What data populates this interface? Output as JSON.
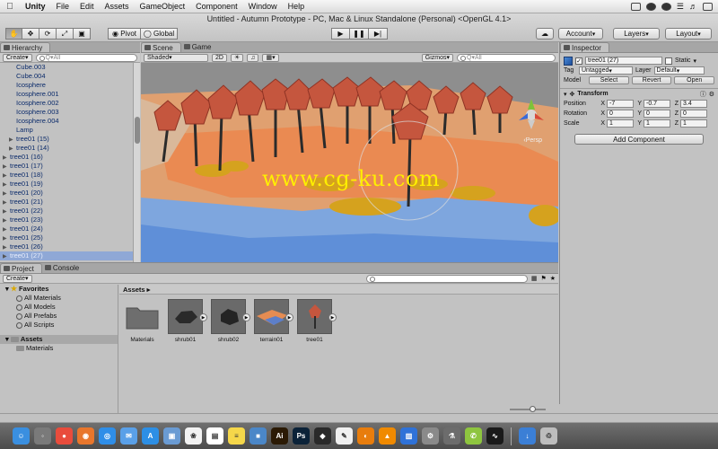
{
  "menubar": {
    "app": "Unity",
    "items": [
      "File",
      "Edit",
      "Assets",
      "GameObject",
      "Component",
      "Window",
      "Help"
    ]
  },
  "window_title": "Untitled - Autumn Prototype - PC, Mac & Linux Standalone (Personal) <OpenGL 4.1>",
  "toolbar": {
    "pivot_label": "Pivot",
    "global_label": "Global",
    "account_label": "Account",
    "layers_label": "Layers",
    "layout_label": "Layout"
  },
  "hierarchy": {
    "tab_label": "Hierarchy",
    "create_label": "Create",
    "search_placeholder": "Q▾All",
    "items": [
      {
        "label": "Cube.003",
        "expandable": false,
        "indent": 1
      },
      {
        "label": "Cube.004",
        "expandable": false,
        "indent": 1
      },
      {
        "label": "Icosphere",
        "expandable": false,
        "indent": 1
      },
      {
        "label": "Icosphere.001",
        "expandable": false,
        "indent": 1
      },
      {
        "label": "Icosphere.002",
        "expandable": false,
        "indent": 1
      },
      {
        "label": "Icosphere.003",
        "expandable": false,
        "indent": 1
      },
      {
        "label": "Icosphere.004",
        "expandable": false,
        "indent": 1
      },
      {
        "label": "Lamp",
        "expandable": false,
        "indent": 1
      },
      {
        "label": "tree01 (15)",
        "expandable": true,
        "indent": 1
      },
      {
        "label": "tree01 (14)",
        "expandable": true,
        "indent": 1
      },
      {
        "label": "tree01 (16)",
        "expandable": true,
        "indent": 0
      },
      {
        "label": "tree01 (17)",
        "expandable": true,
        "indent": 0
      },
      {
        "label": "tree01 (18)",
        "expandable": true,
        "indent": 0
      },
      {
        "label": "tree01 (19)",
        "expandable": true,
        "indent": 0
      },
      {
        "label": "tree01 (20)",
        "expandable": true,
        "indent": 0
      },
      {
        "label": "tree01 (21)",
        "expandable": true,
        "indent": 0
      },
      {
        "label": "tree01 (22)",
        "expandable": true,
        "indent": 0
      },
      {
        "label": "tree01 (23)",
        "expandable": true,
        "indent": 0
      },
      {
        "label": "tree01 (24)",
        "expandable": true,
        "indent": 0
      },
      {
        "label": "tree01 (25)",
        "expandable": true,
        "indent": 0
      },
      {
        "label": "tree01 (26)",
        "expandable": true,
        "indent": 0
      },
      {
        "label": "tree01 (27)",
        "expandable": true,
        "indent": 0,
        "selected": true
      }
    ]
  },
  "scene": {
    "scene_tab": "Scene",
    "game_tab": "Game",
    "shading": "Shaded",
    "mode_2d": "2D",
    "gizmos_label": "Gizmos",
    "search_placeholder": "Q▾All",
    "persp_label": "‹Persp",
    "watermark": "www.cg-ku.com"
  },
  "inspector": {
    "tab_label": "Inspector",
    "object_name": "tree01 (27)",
    "static_label": "Static",
    "tag_label": "Tag",
    "tag_value": "Untagged",
    "layer_label": "Layer",
    "layer_value": "Default",
    "model_label": "Model",
    "model_buttons": [
      "Select",
      "Revert",
      "Open"
    ],
    "transform_label": "Transform",
    "position_label": "Position",
    "rotation_label": "Rotation",
    "scale_label": "Scale",
    "position": {
      "x": "-7",
      "y": "-0.7",
      "z": "3.4"
    },
    "rotation": {
      "x": "0",
      "y": "0",
      "z": "0"
    },
    "scale": {
      "x": "1",
      "y": "1",
      "z": "1"
    },
    "add_component": "Add Component"
  },
  "project": {
    "project_tab": "Project",
    "console_tab": "Console",
    "create_label": "Create",
    "favorites_label": "Favorites",
    "favorites": [
      "All Materials",
      "All Models",
      "All Prefabs",
      "All Scripts"
    ],
    "assets_label": "Assets",
    "asset_folders": [
      "Materials"
    ],
    "breadcrumb": "Assets ▸",
    "assets": [
      {
        "name": "Materials",
        "kind": "folder"
      },
      {
        "name": "shrub01",
        "kind": "model"
      },
      {
        "name": "shrub02",
        "kind": "model"
      },
      {
        "name": "terrain01",
        "kind": "model"
      },
      {
        "name": "tree01",
        "kind": "model"
      }
    ]
  },
  "dock": {
    "apps": [
      {
        "icon": "finder-icon",
        "color": "#3a8fe0",
        "glyph": "☺"
      },
      {
        "icon": "launchpad-icon",
        "color": "#7a7a7a",
        "glyph": "◦"
      },
      {
        "icon": "chrome-icon",
        "color": "#e94c3c",
        "glyph": "●"
      },
      {
        "icon": "firefox-icon",
        "color": "#e8762c",
        "glyph": "◉"
      },
      {
        "icon": "safari-icon",
        "color": "#2f8ee8",
        "glyph": "◎"
      },
      {
        "icon": "mail-icon",
        "color": "#5aa0e8",
        "glyph": "✉"
      },
      {
        "icon": "appstore-icon",
        "color": "#2d8fe5",
        "glyph": "A"
      },
      {
        "icon": "preview-icon",
        "color": "#6a9bd3",
        "glyph": "▣"
      },
      {
        "icon": "photos-icon",
        "color": "#f2f2f2",
        "glyph": "❀"
      },
      {
        "icon": "calendar-icon",
        "color": "#ffffff",
        "glyph": "▤"
      },
      {
        "icon": "notes-icon",
        "color": "#f5d74a",
        "glyph": "≡"
      },
      {
        "icon": "folder-icon",
        "color": "#4b87c8",
        "glyph": "■"
      },
      {
        "icon": "illustrator-icon",
        "color": "#2b1a05",
        "glyph": "Ai"
      },
      {
        "icon": "photoshop-icon",
        "color": "#0b2238",
        "glyph": "Ps"
      },
      {
        "icon": "unity-icon",
        "color": "#2a2a2a",
        "glyph": "◆"
      },
      {
        "icon": "textedit-icon",
        "color": "#f0f0f0",
        "glyph": "✎"
      },
      {
        "icon": "blender-icon",
        "color": "#e87d0d",
        "glyph": "◐"
      },
      {
        "icon": "vlc-icon",
        "color": "#f08a00",
        "glyph": "▲"
      },
      {
        "icon": "keynote-icon",
        "color": "#2f72d8",
        "glyph": "▥"
      },
      {
        "icon": "settings-icon",
        "color": "#8a8a8a",
        "glyph": "⚙"
      },
      {
        "icon": "automator-icon",
        "color": "#6c6c6c",
        "glyph": "⚗"
      },
      {
        "icon": "android-icon",
        "color": "#8ec53f",
        "glyph": "✆"
      },
      {
        "icon": "activity-icon",
        "color": "#1a1a1a",
        "glyph": "∿"
      },
      {
        "icon": "downloads-icon",
        "color": "#3b7fd6",
        "glyph": "↓"
      },
      {
        "icon": "trash-icon",
        "color": "#bdbdbd",
        "glyph": "♲"
      }
    ]
  }
}
